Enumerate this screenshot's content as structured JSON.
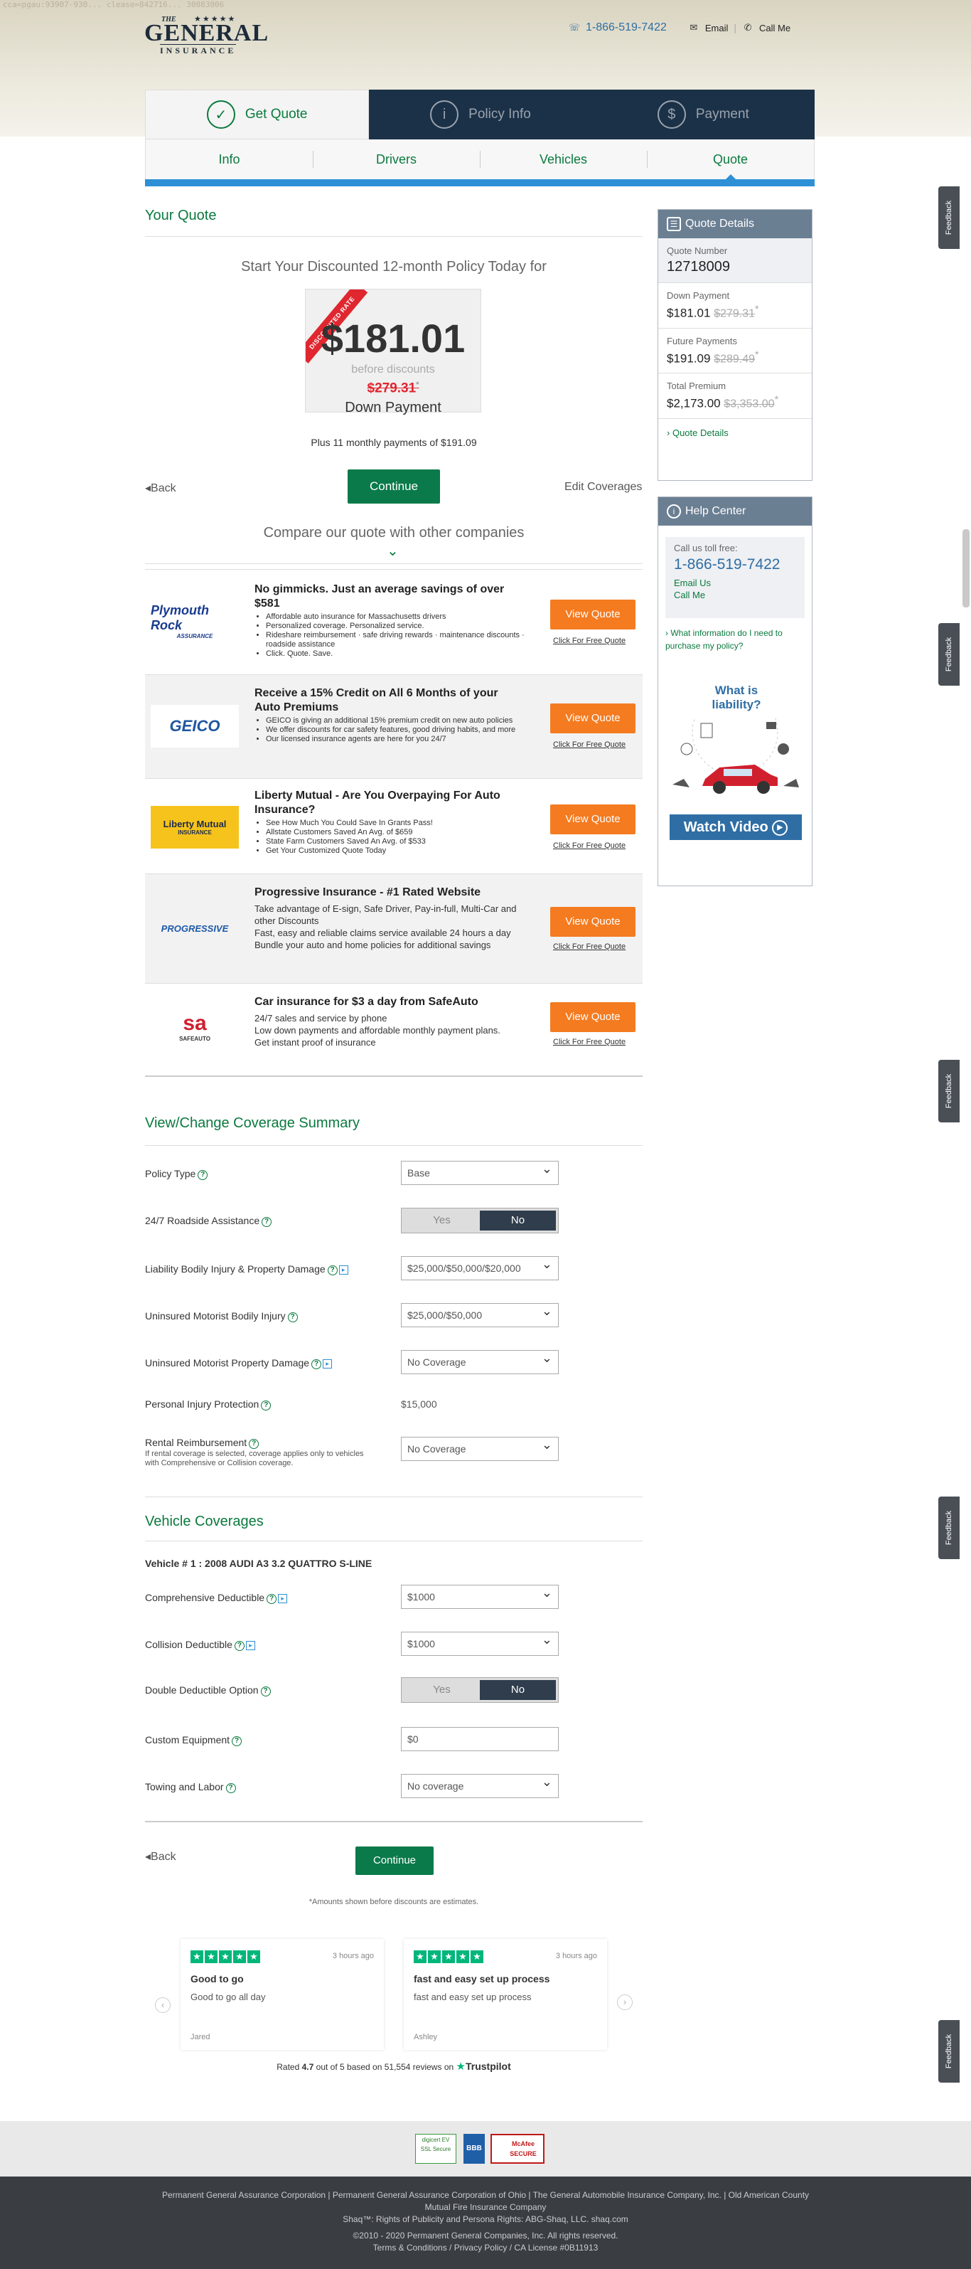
{
  "header": {
    "url_fragment": "cca=pgau:93907-930...     clease=842716...   30083006",
    "phone": "1-866-519-7422",
    "email": "Email",
    "callme": "Call Me",
    "logo": {
      "the": "THE",
      "stars": "★★★★★",
      "name": "GENERAL",
      "sub": "INSURANCE"
    }
  },
  "steps": [
    {
      "label": "Get Quote",
      "icon": "✓"
    },
    {
      "label": "Policy Info",
      "icon": "i"
    },
    {
      "label": "Payment",
      "icon": "$"
    }
  ],
  "subtabs": [
    "Info",
    "Drivers",
    "Vehicles",
    "Quote"
  ],
  "quote": {
    "heading": "Your Quote",
    "start": "Start Your Discounted 12-month Policy Today for",
    "ribbon": "DISCOUNTED RATE",
    "price": "$181.01",
    "before": "before discounts",
    "old_price": "$279.31",
    "asterisk": "*",
    "down": "Down Payment",
    "monthly": "Plus 11 monthly payments of $191.09",
    "back": "Back",
    "continue": "Continue",
    "edit": "Edit Coverages",
    "compare": "Compare our quote with other companies"
  },
  "competitors": [
    {
      "logo": "Plymouth Rock",
      "logo_sub": "ASSURANCE",
      "title": "No gimmicks. Just an average savings of over $581",
      "bullets": [
        "Affordable auto insurance for Massachusetts drivers",
        "Personalized coverage. Personalized service.",
        "Rideshare reimbursement · safe driving rewards · maintenance discounts · roadside assistance",
        "Click. Quote. Save."
      ],
      "cta": "View Quote",
      "link": "Click For Free Quote"
    },
    {
      "logo": "GEICO",
      "logo_sub": "",
      "title": "Receive a 15% Credit on All 6 Months of your Auto Premiums",
      "bullets": [
        "GEICO is giving an additional 15% premium credit on new auto policies",
        "We offer discounts for car safety features, good driving habits, and more",
        "Our licensed insurance agents are here for you 24/7"
      ],
      "cta": "View Quote",
      "link": "Click For Free Quote"
    },
    {
      "logo": "Liberty Mutual",
      "logo_sub": "INSURANCE",
      "title": "Liberty Mutual - Are You Overpaying For Auto Insurance?",
      "bullets": [
        "See How Much You Could Save In Grants Pass!",
        "Allstate Customers Saved An Avg. of $659",
        "State Farm Customers Saved An Avg. of $533",
        "Get Your Customized Quote Today"
      ],
      "cta": "View Quote",
      "link": "Click For Free Quote"
    },
    {
      "logo": "PROGRESSIVE",
      "logo_sub": "",
      "title": "Progressive Insurance - #1 Rated Website",
      "bullets": [
        "Take advantage of E-sign, Safe Driver, Pay-in-full, Multi-Car and other Discounts",
        "Fast, easy and reliable claims service available 24 hours a day",
        "Bundle your auto and home policies for additional savings"
      ],
      "cta": "View Quote",
      "link": "Click For Free Quote"
    },
    {
      "logo": "sa",
      "logo_sub": "SAFEAUTO",
      "title": "Car insurance for $3 a day from SafeAuto",
      "bullets": [
        "24/7 sales and service by phone",
        "Low down payments and affordable monthly payment plans.",
        "Get instant proof of insurance"
      ],
      "cta": "View Quote",
      "link": "Click For Free Quote"
    }
  ],
  "details": {
    "title": "Quote Details",
    "quote_number_label": "Quote Number",
    "quote_number": "12718009",
    "rows": [
      {
        "label": "Down Payment",
        "value": "$181.01",
        "old": "$279.31",
        "ast": "*"
      },
      {
        "label": "Future Payments",
        "value": "$191.09",
        "old": "$289.49",
        "ast": "*"
      },
      {
        "label": "Total Premium",
        "value": "$2,173.00",
        "old": "$3,353.00",
        "ast": "*"
      }
    ],
    "link": "Quote Details"
  },
  "help": {
    "title": "Help Center",
    "call": "Call us toll free:",
    "phone": "1-866-519-7422",
    "email": "Email Us",
    "callme": "Call Me",
    "question": "What information do I need to purchase my policy?",
    "liability_q": "What is liability?",
    "video": "Watch Video"
  },
  "coverage": {
    "heading": "View/Change Coverage Summary",
    "rows": [
      {
        "label": "Policy Type",
        "value": "Base",
        "type": "select"
      },
      {
        "label": "24/7 Roadside Assistance",
        "type": "toggle",
        "yes": "Yes",
        "no": "No"
      },
      {
        "label": "Liability Bodily Injury & Property Damage",
        "value": "$25,000/$50,000/$20,000",
        "type": "select"
      },
      {
        "label": "Uninsured Motorist Bodily Injury",
        "value": "$25,000/$50,000",
        "type": "select"
      },
      {
        "label": "Uninsured Motorist Property Damage",
        "value": "No Coverage",
        "type": "select"
      },
      {
        "label": "Personal Injury Protection",
        "value": "$15,000",
        "type": "text"
      },
      {
        "label": "Rental Reimbursement",
        "value": "No Coverage",
        "type": "select",
        "note": "If rental coverage is selected, coverage applies only to vehicles with Comprehensive or Collision coverage."
      }
    ]
  },
  "vehicle": {
    "heading": "Vehicle Coverages",
    "vehicle": "Vehicle # 1 : 2008 AUDI A3 3.2 QUATTRO S-LINE",
    "rows": [
      {
        "label": "Comprehensive Deductible",
        "value": "$1000",
        "type": "select"
      },
      {
        "label": "Collision Deductible",
        "value": "$1000",
        "type": "select"
      },
      {
        "label": "Double Deductible Option",
        "type": "toggle",
        "yes": "Yes",
        "no": "No"
      },
      {
        "label": "Custom Equipment",
        "value": "$0",
        "type": "input"
      },
      {
        "label": "Towing and Labor",
        "value": "No coverage",
        "type": "select"
      }
    ]
  },
  "bottom": {
    "back": "Back",
    "continue": "Continue",
    "note": "*Amounts shown before discounts are estimates."
  },
  "reviews": [
    {
      "ago": "3 hours ago",
      "title": "Good to go",
      "body": "Good to go all day",
      "author": "Jared"
    },
    {
      "ago": "3 hours ago",
      "title": "fast and easy set up process",
      "body": "fast and easy set up process",
      "author": "Ashley"
    }
  ],
  "trustpilot": {
    "rated": "Rated",
    "score": "4.7",
    "outof": "out of 5 based on",
    "reviews": "51,554 reviews",
    "on": "on",
    "brand": "Trustpilot"
  },
  "badges": [
    "digicert EV SSL Secure",
    "BBB",
    "McAfee SECURE"
  ],
  "footer": {
    "line1": "Permanent General Assurance Corporation | Permanent General Assurance Corporation of Ohio | The General Automobile Insurance Company, Inc. | Old American County Mutual Fire Insurance Company",
    "line2": "Shaq™: Rights of Publicity and Persona Rights: ABG-Shaq, LLC. shaq.com",
    "line3": "©2010 - 2020 Permanent General Companies, Inc. All rights reserved.",
    "terms": "Terms & Conditions",
    "privacy": "Privacy Policy",
    "license": "/ CA License #0B11913"
  },
  "feedback": "Feedback"
}
